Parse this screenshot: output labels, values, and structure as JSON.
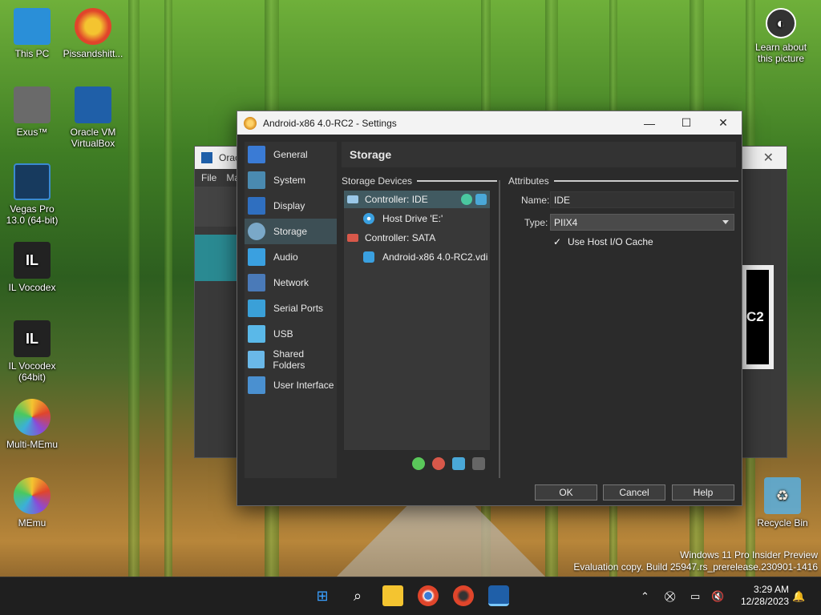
{
  "desktop": {
    "icons": [
      {
        "label": "This PC",
        "icon": "computer-icon",
        "color": "#2a8fd8"
      },
      {
        "label": "Pissandshitt...",
        "icon": "chrome-icon",
        "color": "#e0452b"
      },
      {
        "label": "Exus™",
        "icon": "exus-icon",
        "color": "#6a6a6a"
      },
      {
        "label": "Oracle VM VirtualBox",
        "icon": "virtualbox-icon",
        "color": "#1f5fa8"
      },
      {
        "label": "Vegas Pro 13.0 (64-bit)",
        "icon": "vegas-icon",
        "color": "#173a5e"
      },
      {
        "label": "IL Vocodex",
        "icon": "il-icon",
        "color": "#222222"
      },
      {
        "label": "IL Vocodex (64bit)",
        "icon": "il-icon",
        "color": "#222222"
      },
      {
        "label": "Multi-MEmu",
        "icon": "memu-icon",
        "color": "#3bb0d8"
      },
      {
        "label": "MEmu",
        "icon": "memu-icon",
        "color": "#3bb0d8"
      },
      {
        "label": "Recycle Bin",
        "icon": "recycle-bin-icon",
        "color": "#5ab0e0"
      }
    ],
    "learn_about": "Learn about this picture",
    "watermark_line1": "Windows 11 Pro Insider Preview",
    "watermark_line2": "Evaluation copy. Build 25947.rs_prerelease.230901-1416"
  },
  "bg_window": {
    "title": "Orac",
    "menu": [
      "File",
      "Ma"
    ],
    "preview_text": "C2"
  },
  "dialog": {
    "title": "Android-x86 4.0-RC2 - Settings",
    "nav": [
      {
        "label": "General",
        "icon": "general-icon",
        "color": "#3a7bd5"
      },
      {
        "label": "System",
        "icon": "system-icon",
        "color": "#4a8ab0"
      },
      {
        "label": "Display",
        "icon": "display-icon",
        "color": "#2f6fc0"
      },
      {
        "label": "Storage",
        "icon": "storage-icon",
        "color": "#7aa8c8",
        "active": true
      },
      {
        "label": "Audio",
        "icon": "audio-icon",
        "color": "#3aa0e0"
      },
      {
        "label": "Network",
        "icon": "network-icon",
        "color": "#4a7ab8"
      },
      {
        "label": "Serial Ports",
        "icon": "serial-ports-icon",
        "color": "#3aa0d8"
      },
      {
        "label": "USB",
        "icon": "usb-icon",
        "color": "#5ab8e8"
      },
      {
        "label": "Shared Folders",
        "icon": "shared-folders-icon",
        "color": "#6ab8e8"
      },
      {
        "label": "User Interface",
        "icon": "user-interface-icon",
        "color": "#4a90d0"
      }
    ],
    "heading": "Storage",
    "storage_devices_label": "Storage Devices",
    "attributes_label": "Attributes",
    "tree": {
      "controller_ide": "Controller: IDE",
      "host_drive": "Host Drive 'E:'",
      "controller_sata": "Controller: SATA",
      "vdi": "Android-x86 4.0-RC2.vdi"
    },
    "attributes": {
      "name_label": "Name:",
      "name_value": "IDE",
      "type_label": "Type:",
      "type_value": "PIIX4",
      "cache_check": "✓",
      "cache_label": "Use Host I/O Cache"
    },
    "buttons": {
      "ok": "OK",
      "cancel": "Cancel",
      "help": "Help"
    }
  },
  "taskbar": {
    "time": "3:29 AM",
    "date": "12/28/2023"
  }
}
